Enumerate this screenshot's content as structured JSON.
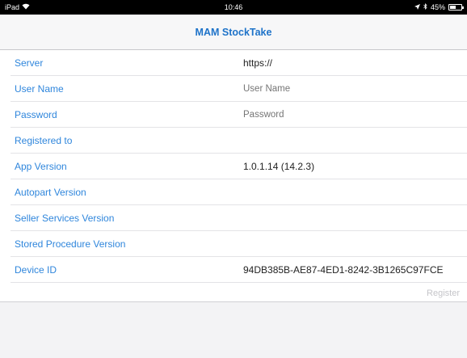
{
  "status": {
    "device": "iPad",
    "time": "10:46",
    "battery": "45%"
  },
  "nav": {
    "title": "MAM StockTake"
  },
  "form": {
    "server_label": "Server",
    "server_value": "https://",
    "username_label": "User Name",
    "username_placeholder": "User Name",
    "password_label": "Password",
    "password_placeholder": "Password",
    "registered_label": "Registered to",
    "registered_value": "",
    "app_version_label": "App Version",
    "app_version_value": "1.0.1.14 (14.2.3)",
    "autopart_label": "Autopart Version",
    "seller_label": "Seller Services Version",
    "stored_proc_label": "Stored Procedure Version",
    "device_id_label": "Device ID",
    "device_id_value": "94DB385B-AE87-4ED1-8242-3B1265C97FCE"
  },
  "actions": {
    "register_label": "Register"
  },
  "colors": {
    "accent": "#2f86dc",
    "title": "#1e73c9"
  }
}
